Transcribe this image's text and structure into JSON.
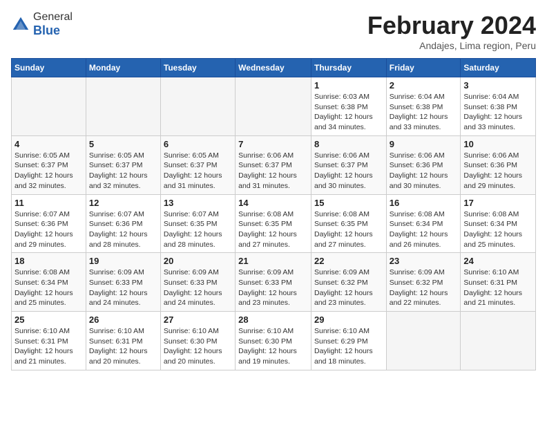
{
  "header": {
    "logo_general": "General",
    "logo_blue": "Blue",
    "month_year": "February 2024",
    "location": "Andajes, Lima region, Peru"
  },
  "calendar": {
    "days_of_week": [
      "Sunday",
      "Monday",
      "Tuesday",
      "Wednesday",
      "Thursday",
      "Friday",
      "Saturday"
    ],
    "weeks": [
      [
        {
          "day": "",
          "info": ""
        },
        {
          "day": "",
          "info": ""
        },
        {
          "day": "",
          "info": ""
        },
        {
          "day": "",
          "info": ""
        },
        {
          "day": "1",
          "info": "Sunrise: 6:03 AM\nSunset: 6:38 PM\nDaylight: 12 hours\nand 34 minutes."
        },
        {
          "day": "2",
          "info": "Sunrise: 6:04 AM\nSunset: 6:38 PM\nDaylight: 12 hours\nand 33 minutes."
        },
        {
          "day": "3",
          "info": "Sunrise: 6:04 AM\nSunset: 6:38 PM\nDaylight: 12 hours\nand 33 minutes."
        }
      ],
      [
        {
          "day": "4",
          "info": "Sunrise: 6:05 AM\nSunset: 6:37 PM\nDaylight: 12 hours\nand 32 minutes."
        },
        {
          "day": "5",
          "info": "Sunrise: 6:05 AM\nSunset: 6:37 PM\nDaylight: 12 hours\nand 32 minutes."
        },
        {
          "day": "6",
          "info": "Sunrise: 6:05 AM\nSunset: 6:37 PM\nDaylight: 12 hours\nand 31 minutes."
        },
        {
          "day": "7",
          "info": "Sunrise: 6:06 AM\nSunset: 6:37 PM\nDaylight: 12 hours\nand 31 minutes."
        },
        {
          "day": "8",
          "info": "Sunrise: 6:06 AM\nSunset: 6:37 PM\nDaylight: 12 hours\nand 30 minutes."
        },
        {
          "day": "9",
          "info": "Sunrise: 6:06 AM\nSunset: 6:36 PM\nDaylight: 12 hours\nand 30 minutes."
        },
        {
          "day": "10",
          "info": "Sunrise: 6:06 AM\nSunset: 6:36 PM\nDaylight: 12 hours\nand 29 minutes."
        }
      ],
      [
        {
          "day": "11",
          "info": "Sunrise: 6:07 AM\nSunset: 6:36 PM\nDaylight: 12 hours\nand 29 minutes."
        },
        {
          "day": "12",
          "info": "Sunrise: 6:07 AM\nSunset: 6:36 PM\nDaylight: 12 hours\nand 28 minutes."
        },
        {
          "day": "13",
          "info": "Sunrise: 6:07 AM\nSunset: 6:35 PM\nDaylight: 12 hours\nand 28 minutes."
        },
        {
          "day": "14",
          "info": "Sunrise: 6:08 AM\nSunset: 6:35 PM\nDaylight: 12 hours\nand 27 minutes."
        },
        {
          "day": "15",
          "info": "Sunrise: 6:08 AM\nSunset: 6:35 PM\nDaylight: 12 hours\nand 27 minutes."
        },
        {
          "day": "16",
          "info": "Sunrise: 6:08 AM\nSunset: 6:34 PM\nDaylight: 12 hours\nand 26 minutes."
        },
        {
          "day": "17",
          "info": "Sunrise: 6:08 AM\nSunset: 6:34 PM\nDaylight: 12 hours\nand 25 minutes."
        }
      ],
      [
        {
          "day": "18",
          "info": "Sunrise: 6:08 AM\nSunset: 6:34 PM\nDaylight: 12 hours\nand 25 minutes."
        },
        {
          "day": "19",
          "info": "Sunrise: 6:09 AM\nSunset: 6:33 PM\nDaylight: 12 hours\nand 24 minutes."
        },
        {
          "day": "20",
          "info": "Sunrise: 6:09 AM\nSunset: 6:33 PM\nDaylight: 12 hours\nand 24 minutes."
        },
        {
          "day": "21",
          "info": "Sunrise: 6:09 AM\nSunset: 6:33 PM\nDaylight: 12 hours\nand 23 minutes."
        },
        {
          "day": "22",
          "info": "Sunrise: 6:09 AM\nSunset: 6:32 PM\nDaylight: 12 hours\nand 23 minutes."
        },
        {
          "day": "23",
          "info": "Sunrise: 6:09 AM\nSunset: 6:32 PM\nDaylight: 12 hours\nand 22 minutes."
        },
        {
          "day": "24",
          "info": "Sunrise: 6:10 AM\nSunset: 6:31 PM\nDaylight: 12 hours\nand 21 minutes."
        }
      ],
      [
        {
          "day": "25",
          "info": "Sunrise: 6:10 AM\nSunset: 6:31 PM\nDaylight: 12 hours\nand 21 minutes."
        },
        {
          "day": "26",
          "info": "Sunrise: 6:10 AM\nSunset: 6:31 PM\nDaylight: 12 hours\nand 20 minutes."
        },
        {
          "day": "27",
          "info": "Sunrise: 6:10 AM\nSunset: 6:30 PM\nDaylight: 12 hours\nand 20 minutes."
        },
        {
          "day": "28",
          "info": "Sunrise: 6:10 AM\nSunset: 6:30 PM\nDaylight: 12 hours\nand 19 minutes."
        },
        {
          "day": "29",
          "info": "Sunrise: 6:10 AM\nSunset: 6:29 PM\nDaylight: 12 hours\nand 18 minutes."
        },
        {
          "day": "",
          "info": ""
        },
        {
          "day": "",
          "info": ""
        }
      ]
    ]
  }
}
